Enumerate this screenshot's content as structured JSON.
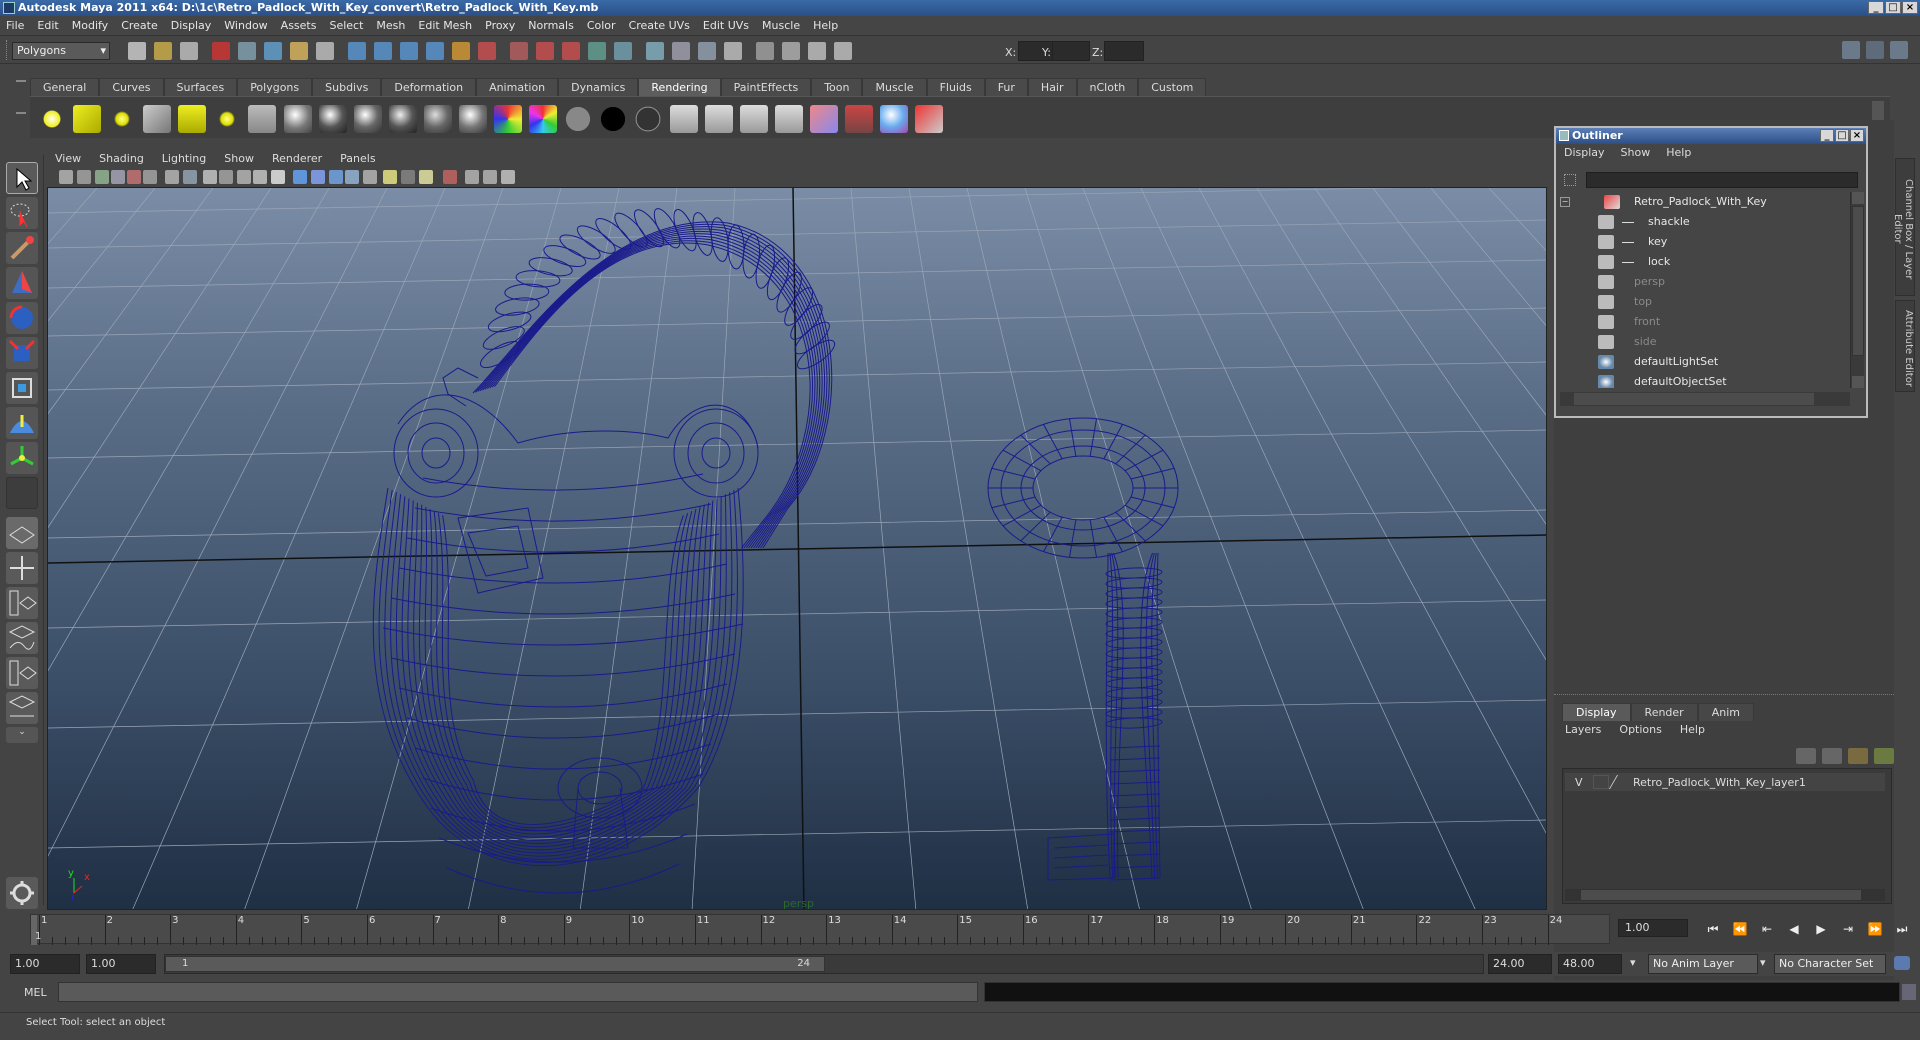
{
  "window": {
    "title": "Autodesk Maya 2011 x64: D:\\1c\\Retro_Padlock_With_Key_convert\\Retro_Padlock_With_Key.mb",
    "controls": [
      "_",
      "□",
      "×"
    ]
  },
  "menubar": [
    "File",
    "Edit",
    "Modify",
    "Create",
    "Display",
    "Window",
    "Assets",
    "Select",
    "Mesh",
    "Edit Mesh",
    "Proxy",
    "Normals",
    "Color",
    "Create UVs",
    "Edit UVs",
    "Muscle",
    "Help"
  ],
  "statusline": {
    "mode": "Polygons",
    "x_label": "X:",
    "y_label": "Y:",
    "z_label": "Z:"
  },
  "shelf": {
    "tabs": [
      "General",
      "Curves",
      "Surfaces",
      "Polygons",
      "Subdivs",
      "Deformation",
      "Animation",
      "Dynamics",
      "Rendering",
      "PaintEffects",
      "Toon",
      "Muscle",
      "Fluids",
      "Fur",
      "Hair",
      "nCloth",
      "Custom"
    ],
    "active_tab": "Rendering"
  },
  "viewport": {
    "menu": [
      "View",
      "Shading",
      "Lighting",
      "Show",
      "Renderer",
      "Panels"
    ],
    "camera_label": "persp",
    "axis_labels": {
      "x": "x",
      "y": "y"
    },
    "colors": {
      "wire": "#1a1a8c",
      "grid": "#9aa6b6"
    }
  },
  "outliner": {
    "title": "Outliner",
    "menu": [
      "Display",
      "Show",
      "Help"
    ],
    "items": [
      {
        "label": "Retro_Padlock_With_Key",
        "indent": 0,
        "dim": false
      },
      {
        "label": "shackle",
        "indent": 1,
        "dim": false
      },
      {
        "label": "key",
        "indent": 1,
        "dim": false
      },
      {
        "label": "lock",
        "indent": 1,
        "dim": false
      },
      {
        "label": "persp",
        "indent": 0,
        "dim": true
      },
      {
        "label": "top",
        "indent": 0,
        "dim": true
      },
      {
        "label": "front",
        "indent": 0,
        "dim": true
      },
      {
        "label": "side",
        "indent": 0,
        "dim": true
      },
      {
        "label": "defaultLightSet",
        "indent": 0,
        "dim": false
      },
      {
        "label": "defaultObjectSet",
        "indent": 0,
        "dim": false
      }
    ]
  },
  "side_tabs": [
    "Channel Box / Layer Editor",
    "Attribute Editor"
  ],
  "layer_editor": {
    "tabs": [
      "Display",
      "Render",
      "Anim"
    ],
    "menu": [
      "Layers",
      "Options",
      "Help"
    ],
    "layer": {
      "visible": "V",
      "name": "Retro_Padlock_With_Key_layer1"
    }
  },
  "timeline": {
    "ticks": [
      "1",
      "2",
      "3",
      "4",
      "5",
      "6",
      "7",
      "8",
      "9",
      "10",
      "11",
      "12",
      "13",
      "14",
      "15",
      "16",
      "17",
      "18",
      "19",
      "20",
      "21",
      "22",
      "23",
      "24"
    ],
    "current_frame": "1",
    "current_time": "1.00"
  },
  "range": {
    "start": "1.00",
    "playback_start": "1.00",
    "slider_start": "1",
    "slider_end": "24",
    "playback_end": "24.00",
    "end": "48.00",
    "anim_layer": "No Anim Layer",
    "character_set": "No Character Set"
  },
  "command_line": {
    "label": "MEL"
  },
  "help_line": "Select Tool: select an object"
}
